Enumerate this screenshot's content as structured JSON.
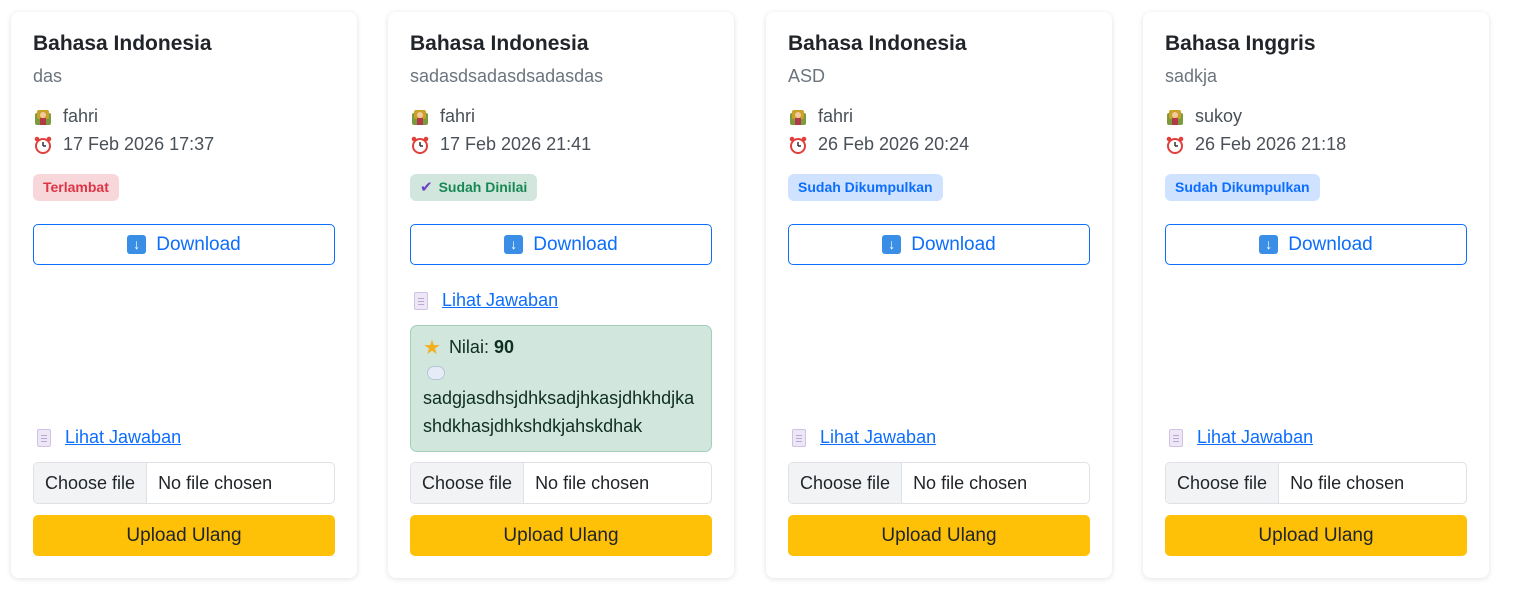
{
  "cards": [
    {
      "title": "Bahasa Indonesia",
      "description": "das",
      "teacher": "fahri",
      "deadline": "17 Feb 2026 17:37",
      "status": "Terlambat",
      "status_colors": {
        "bg": "#f8d7da",
        "fg": "#dc3545"
      },
      "download_label": "Download",
      "view_answer_label": "Lihat Jawaban",
      "file_button_label": "Choose file",
      "file_status": "No file chosen",
      "upload_label": "Upload Ulang"
    },
    {
      "title": "Bahasa Indonesia",
      "description": "sadasdsadasdsadasdas",
      "teacher": "fahri",
      "deadline": "17 Feb 2026 21:41",
      "status": "Sudah Dinilai",
      "status_colors": {
        "bg": "#d1e7dd",
        "fg": "#198754"
      },
      "download_label": "Download",
      "view_answer_label": "Lihat Jawaban",
      "grade_label": "Nilai:",
      "grade_value": "90",
      "comment": "sadgjasdhsjdhksadjhkasjdhkhdjkashdkhasjdhkshdkjahskdhak",
      "file_button_label": "Choose file",
      "file_status": "No file chosen",
      "upload_label": "Upload Ulang"
    },
    {
      "title": "Bahasa Indonesia",
      "description": "ASD",
      "teacher": "fahri",
      "deadline": "26 Feb 2026 20:24",
      "status": "Sudah Dikumpulkan",
      "status_colors": {
        "bg": "#cfe2ff",
        "fg": "#0d6efd"
      },
      "download_label": "Download",
      "view_answer_label": "Lihat Jawaban",
      "file_button_label": "Choose file",
      "file_status": "No file chosen",
      "upload_label": "Upload Ulang"
    },
    {
      "title": "Bahasa Inggris",
      "description": "sadkja",
      "teacher": "sukoy",
      "deadline": "26 Feb 2026 21:18",
      "status": "Sudah Dikumpulkan",
      "status_colors": {
        "bg": "#cfe2ff",
        "fg": "#0d6efd"
      },
      "download_label": "Download",
      "view_answer_label": "Lihat Jawaban",
      "file_button_label": "Choose file",
      "file_status": "No file chosen",
      "upload_label": "Upload Ulang"
    }
  ],
  "icons": {
    "teacher": "teacher-icon",
    "deadline": "alarm-clock-icon",
    "download": "download-arrow-icon",
    "answer": "document-icon",
    "grade": "star-icon",
    "comment": "speech-bubble-icon",
    "graded_check": "check-icon"
  }
}
